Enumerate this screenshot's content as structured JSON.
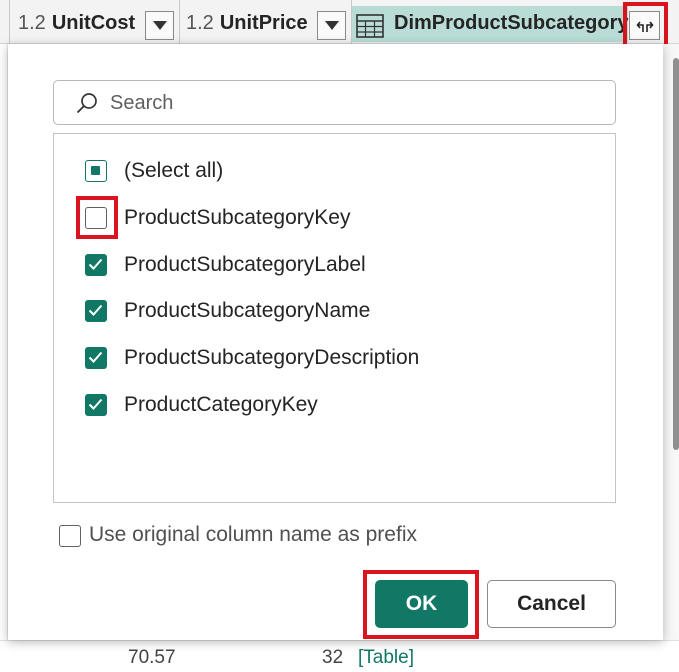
{
  "header": {
    "columns": [
      {
        "type": "1.2",
        "name": "UnitCost"
      },
      {
        "type": "1.2",
        "name": "UnitPrice"
      },
      {
        "type_icon": "table-icon",
        "name": "DimProductSubcategory"
      }
    ]
  },
  "background": {
    "bottom_row": {
      "value1": "70.57",
      "value2": "32",
      "cell": "[Table]"
    }
  },
  "panel": {
    "search": {
      "placeholder": "Search",
      "value": ""
    },
    "items": [
      {
        "label": "(Select all)",
        "state": "partial"
      },
      {
        "label": "ProductSubcategoryKey",
        "state": "unchecked"
      },
      {
        "label": "ProductSubcategoryLabel",
        "state": "checked"
      },
      {
        "label": "ProductSubcategoryName",
        "state": "checked"
      },
      {
        "label": "ProductSubcategoryDescription",
        "state": "checked"
      },
      {
        "label": "ProductCategoryKey",
        "state": "checked"
      }
    ],
    "prefix_option": {
      "label": "Use original column name as prefix",
      "checked": false
    },
    "ok_label": "OK",
    "cancel_label": "Cancel"
  },
  "colors": {
    "accent": "#117865",
    "highlight_box": "#d9141e",
    "selected_column": "#b9ddd6"
  }
}
